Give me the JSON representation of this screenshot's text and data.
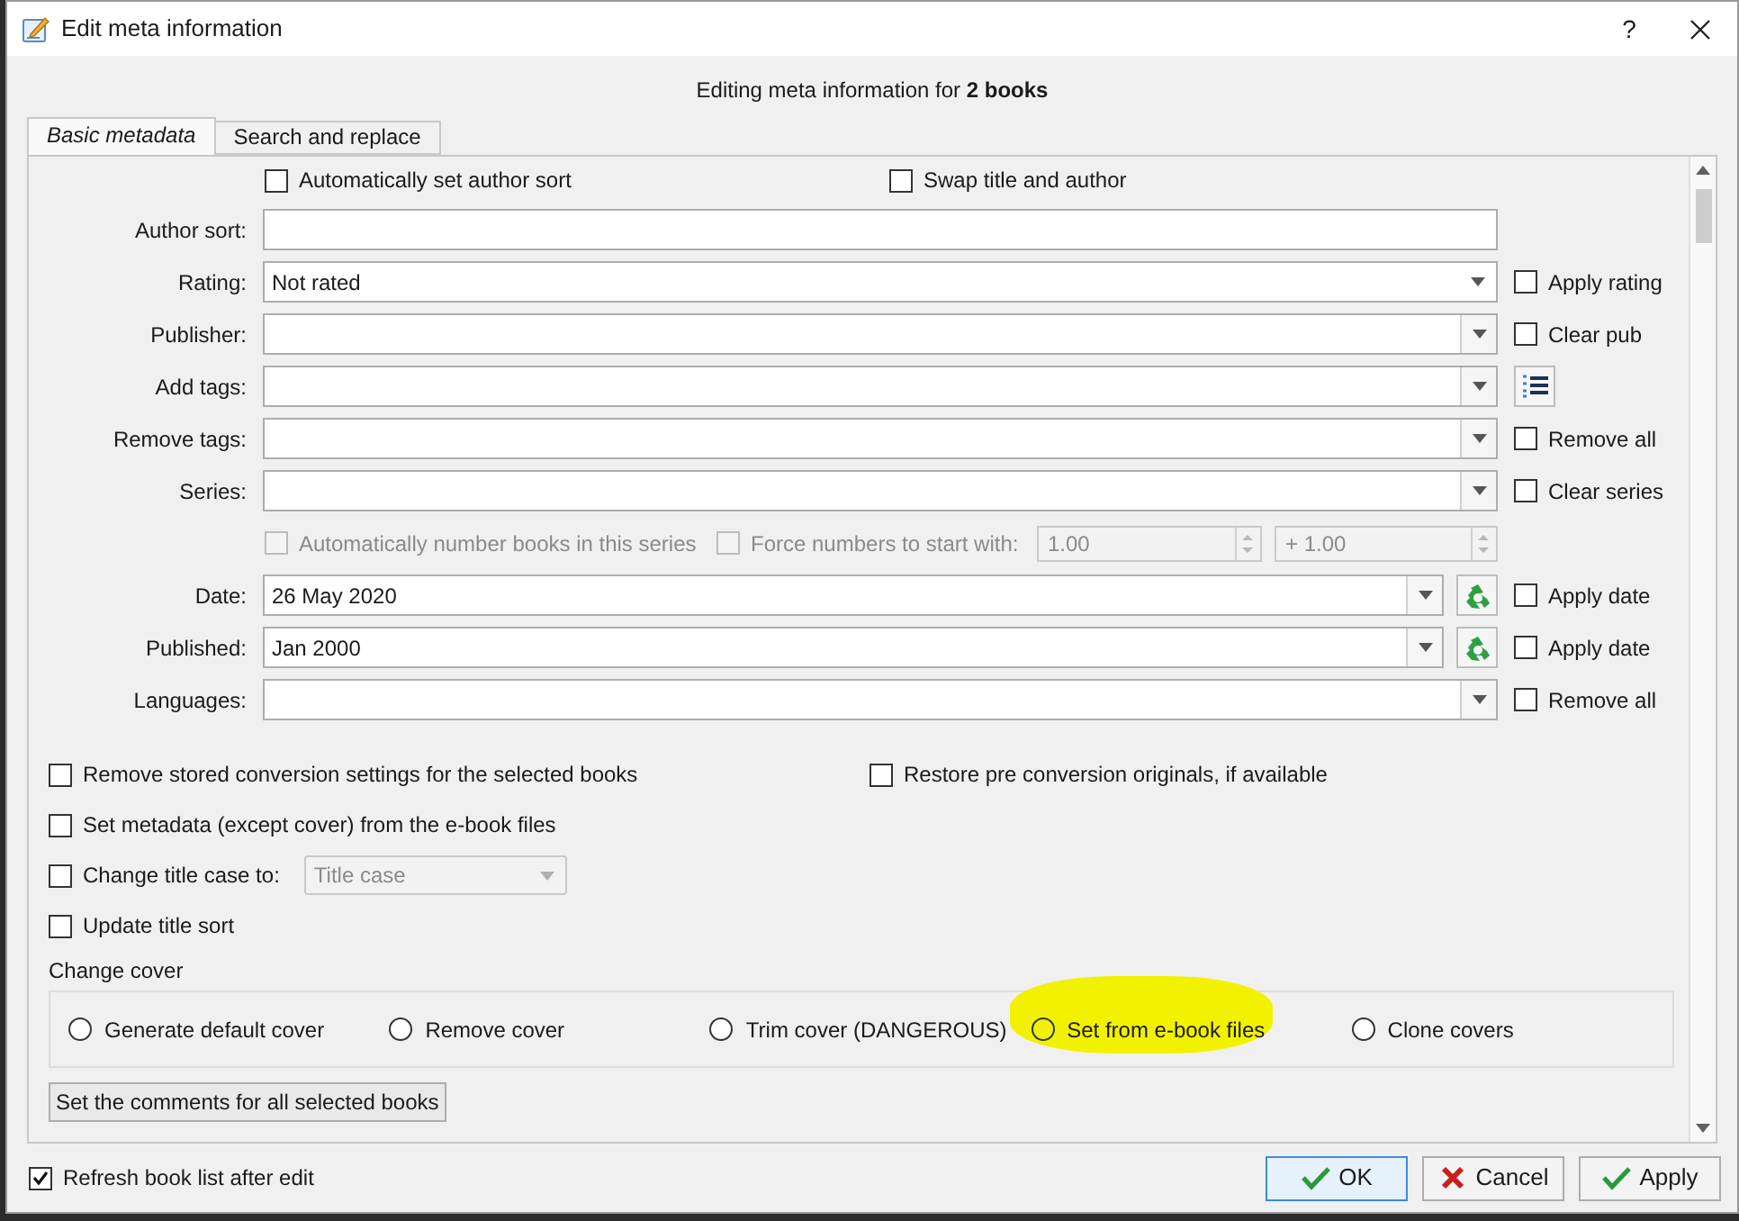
{
  "window": {
    "title": "Edit meta information",
    "help": "?"
  },
  "heading": "Editing meta information for **2 books**",
  "tabs": [
    {
      "label": "Basic metadata",
      "selected": true
    },
    {
      "label": "Search and replace",
      "selected": false
    }
  ],
  "top_options": [
    {
      "label": "Automatically set author sort",
      "checked": false
    },
    {
      "label": "Swap title and author",
      "checked": false
    }
  ],
  "fields": [
    {
      "kind": "text",
      "label": "Author sort:"
    },
    {
      "kind": "combo",
      "label": "Rating:",
      "value": "Not rated",
      "editable": false,
      "side": {
        "kind": "checkbox",
        "label": "Apply rating",
        "checked": false
      }
    },
    {
      "kind": "combo",
      "label": "Publisher:",
      "editable": true,
      "side": {
        "kind": "checkbox",
        "label": "Clear pub",
        "checked": false
      }
    },
    {
      "kind": "combo",
      "label": "Add tags:",
      "editable": true,
      "side": {
        "kind": "tag_list_button"
      }
    },
    {
      "kind": "combo",
      "label": "Remove tags:",
      "editable": true,
      "side": {
        "kind": "checkbox",
        "label": "Remove all",
        "checked": false
      }
    },
    {
      "kind": "combo",
      "label": "Series:",
      "editable": true,
      "side": {
        "kind": "checkbox",
        "label": "Clear series",
        "checked": false
      }
    },
    {
      "kind": "numbering",
      "auto": {
        "label": "Automatically number books in this series",
        "checked": false,
        "disabled": true
      },
      "force": {
        "label": "Force numbers to start with:",
        "checked": false,
        "disabled": true
      },
      "start": "1.00",
      "increment": "+ 1.00"
    },
    {
      "kind": "date",
      "label": "Date:",
      "value": "26 May 2020",
      "side": {
        "kind": "checkbox",
        "label": "Apply date",
        "checked": false
      }
    },
    {
      "kind": "date",
      "label": "Published:",
      "value": "Jan 2000",
      "side": {
        "kind": "checkbox",
        "label": "Apply date",
        "checked": false
      }
    },
    {
      "kind": "combo",
      "label": "Languages:",
      "editable": true,
      "side": {
        "kind": "checkbox",
        "label": "Remove all",
        "checked": false
      }
    }
  ],
  "option_rows": [
    [
      {
        "kind": "checkbox",
        "label": "Remove stored conversion settings for the selected books",
        "checked": false
      },
      {
        "kind": "checkbox",
        "label": "Restore pre conversion originals, if available",
        "checked": false
      }
    ],
    [
      {
        "kind": "checkbox",
        "label": "Set metadata (except cover) from the e-book files",
        "checked": false
      }
    ],
    [
      {
        "kind": "checkbox_combo",
        "label": "Change title case to:",
        "checked": false,
        "value": "Title case",
        "disabled": true
      }
    ],
    [
      {
        "kind": "checkbox",
        "label": "Update title sort",
        "checked": false
      }
    ]
  ],
  "change_cover": {
    "label": "Change cover",
    "options": [
      {
        "label": "Generate default cover",
        "selected": false,
        "highlighted": false
      },
      {
        "label": "Remove cover",
        "selected": false,
        "highlighted": false
      },
      {
        "label": "Trim cover (DANGEROUS)",
        "selected": false,
        "highlighted": false
      },
      {
        "label": "Set from e-book files",
        "selected": false,
        "highlighted": true
      },
      {
        "label": "Clone covers",
        "selected": false,
        "highlighted": false
      }
    ]
  },
  "comments_button": "Set the comments for all selected books",
  "refresh": {
    "label": "Refresh book list after edit",
    "checked": true
  },
  "buttons": [
    {
      "kind": "ok",
      "label": "OK",
      "default": true
    },
    {
      "kind": "cancel",
      "label": "Cancel",
      "default": false
    },
    {
      "kind": "apply",
      "label": "Apply",
      "default": false
    }
  ]
}
